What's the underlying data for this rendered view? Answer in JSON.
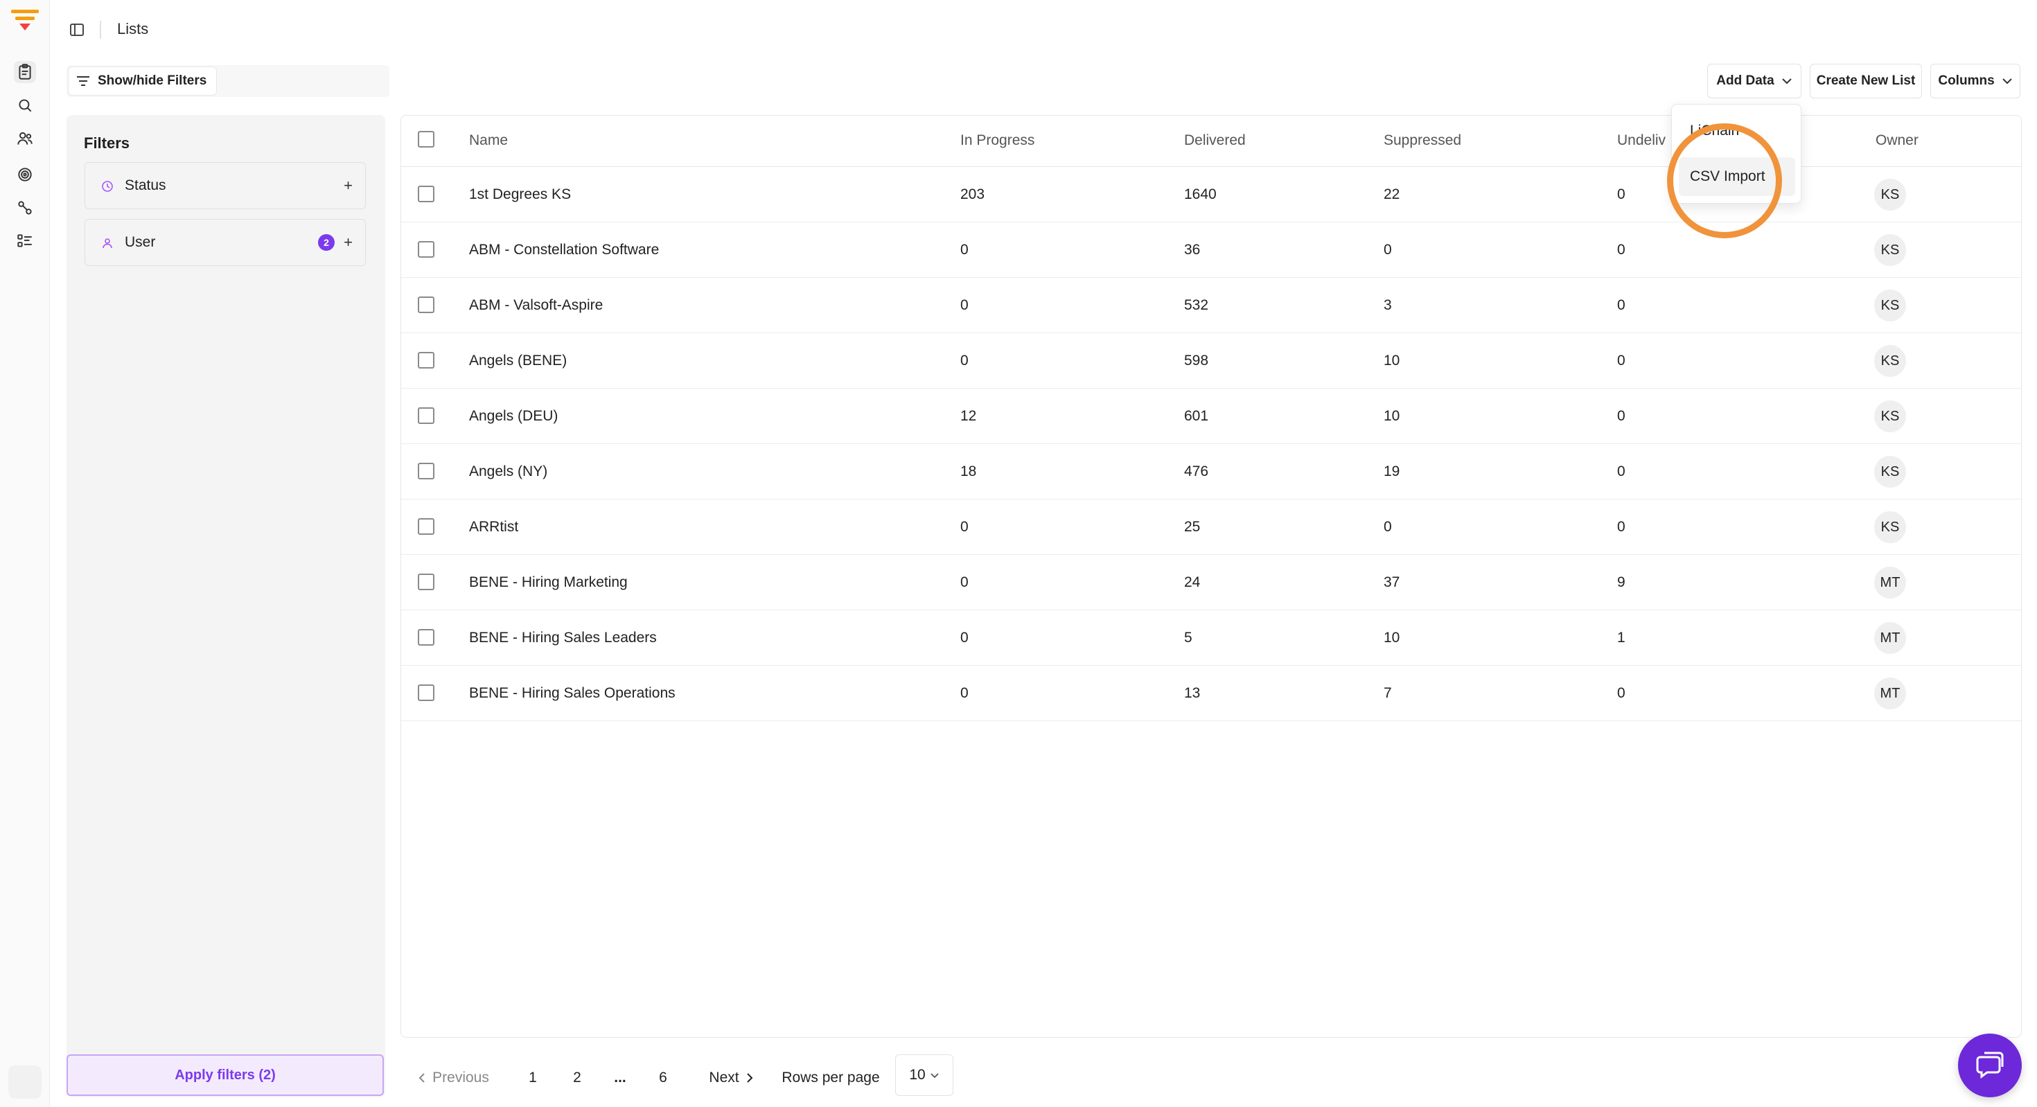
{
  "header": {
    "title": "Lists"
  },
  "toolbar": {
    "show_hide_filters": "Show/hide Filters",
    "add_data": "Add Data",
    "create_new_list": "Create New List",
    "columns": "Columns"
  },
  "filters": {
    "title": "Filters",
    "items": [
      {
        "label": "Status",
        "badge": ""
      },
      {
        "label": "User",
        "badge": "2"
      }
    ],
    "apply_label": "Apply filters (2)"
  },
  "dropdown": {
    "items": [
      "LiChain",
      "CSV Import"
    ]
  },
  "table": {
    "columns": [
      "Name",
      "In Progress",
      "Delivered",
      "Suppressed",
      "Undeliv",
      "Owner"
    ],
    "rows": [
      {
        "name": "1st Degrees KS",
        "in_progress": "203",
        "delivered": "1640",
        "suppressed": "22",
        "undelivered": "0",
        "owner": "KS"
      },
      {
        "name": "ABM - Constellation Software",
        "in_progress": "0",
        "delivered": "36",
        "suppressed": "0",
        "undelivered": "0",
        "owner": "KS"
      },
      {
        "name": "ABM - Valsoft-Aspire",
        "in_progress": "0",
        "delivered": "532",
        "suppressed": "3",
        "undelivered": "0",
        "owner": "KS"
      },
      {
        "name": "Angels (BENE)",
        "in_progress": "0",
        "delivered": "598",
        "suppressed": "10",
        "undelivered": "0",
        "owner": "KS"
      },
      {
        "name": "Angels (DEU)",
        "in_progress": "12",
        "delivered": "601",
        "suppressed": "10",
        "undelivered": "0",
        "owner": "KS"
      },
      {
        "name": "Angels (NY)",
        "in_progress": "18",
        "delivered": "476",
        "suppressed": "19",
        "undelivered": "0",
        "owner": "KS"
      },
      {
        "name": "ARRtist",
        "in_progress": "0",
        "delivered": "25",
        "suppressed": "0",
        "undelivered": "0",
        "owner": "KS"
      },
      {
        "name": "BENE - Hiring Marketing",
        "in_progress": "0",
        "delivered": "24",
        "suppressed": "37",
        "undelivered": "9",
        "owner": "MT"
      },
      {
        "name": "BENE - Hiring Sales Leaders",
        "in_progress": "0",
        "delivered": "5",
        "suppressed": "10",
        "undelivered": "1",
        "owner": "MT"
      },
      {
        "name": "BENE - Hiring Sales Operations",
        "in_progress": "0",
        "delivered": "13",
        "suppressed": "7",
        "undelivered": "0",
        "owner": "MT"
      }
    ]
  },
  "pagination": {
    "previous": "Previous",
    "pages": [
      "1",
      "2",
      "...",
      "6"
    ],
    "next": "Next",
    "rows_per_page_label": "Rows per page",
    "rows_per_page_value": "10"
  },
  "colors": {
    "accent": "#7c3aed",
    "highlight_ring": "#f0933b",
    "logo": "#f59e0b"
  }
}
